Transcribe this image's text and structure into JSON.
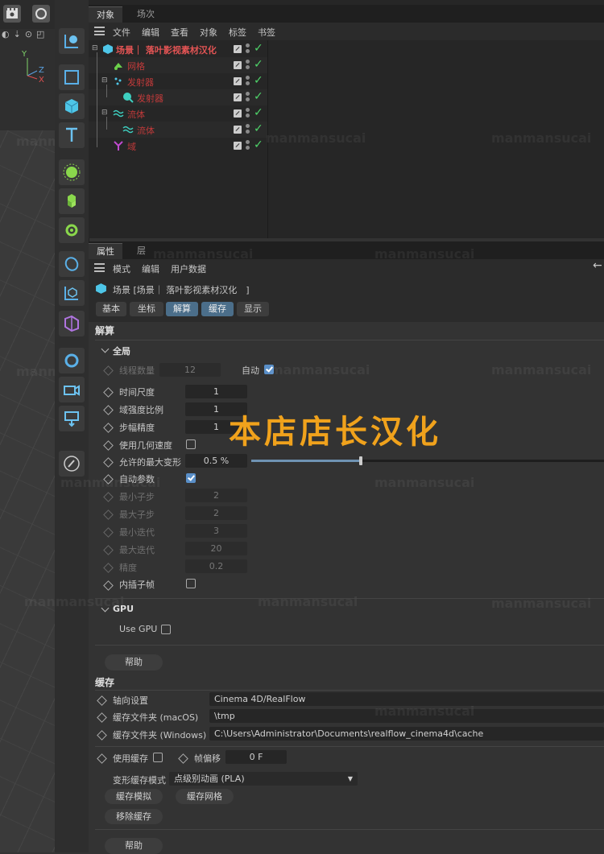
{
  "object_manager": {
    "tabs": [
      "对象",
      "场次"
    ],
    "menu": [
      "文件",
      "编辑",
      "查看",
      "对象",
      "标签",
      "书签"
    ],
    "objects": [
      {
        "name": "场景｜ 落叶影视素材汉化",
        "color": "#e05050",
        "icon": "scene-icon"
      },
      {
        "name": "网格",
        "color": "#c03a3a",
        "icon": "mesh-icon"
      },
      {
        "name": "发射器",
        "color": "#c03a3a",
        "icon": "emitter-icon"
      },
      {
        "name": "发射器",
        "color": "#c03a3a",
        "icon": "emitter-child-icon"
      },
      {
        "name": "流体",
        "color": "#c03a3a",
        "icon": "fluid-icon"
      },
      {
        "name": "流体",
        "color": "#c03a3a",
        "icon": "fluid-child-icon"
      },
      {
        "name": "域",
        "color": "#c03a3a",
        "icon": "domain-icon"
      }
    ]
  },
  "attributes": {
    "tabs": [
      "属性",
      "层"
    ],
    "menu": [
      "模式",
      "编辑",
      "用户数据"
    ],
    "object_title": "场景 [场景｜ 落叶影视素材汉化　]",
    "subtabs": [
      "基本",
      "坐标",
      "解算",
      "缓存",
      "显示"
    ],
    "section_solver": "解算",
    "group_global": "全局",
    "params": [
      {
        "label": "线程数量",
        "value": "12",
        "dim": true
      },
      {
        "label": "时间尺度",
        "value": "1",
        "dim": false
      },
      {
        "label": "域强度比例",
        "value": "1",
        "dim": false
      },
      {
        "label": "步幅精度",
        "value": "1",
        "dim": false
      },
      {
        "label": "使用几何速度",
        "value": "",
        "dim": false
      },
      {
        "label": "允许的最大变形",
        "value": "0.5 %",
        "dim": false
      },
      {
        "label": "自动参数",
        "value": "",
        "dim": false
      },
      {
        "label": "最小子步",
        "value": "2",
        "dim": true
      },
      {
        "label": "最大子步",
        "value": "2",
        "dim": true
      },
      {
        "label": "最小迭代",
        "value": "3",
        "dim": true
      },
      {
        "label": "最大迭代",
        "value": "20",
        "dim": true
      },
      {
        "label": "精度",
        "value": "0.2",
        "dim": true
      },
      {
        "label": "内插子帧",
        "value": "",
        "dim": false
      }
    ],
    "auto_label": "自动",
    "max_deform_slider": 0.31,
    "group_gpu": "GPU",
    "use_gpu_label": "Use GPU",
    "help_label": "帮助",
    "section_cache": "缓存",
    "axis_label": "轴向设置",
    "axis_value": "Cinema 4D/RealFlow",
    "cache_mac_label": "缓存文件夹 (macOS)",
    "cache_mac_value": "\\tmp",
    "cache_win_label": "缓存文件夹 (Windows)",
    "cache_win_value": "C:\\Users\\Administrator\\Documents\\realflow_cinema4d\\cache",
    "use_cache_label": "使用缓存",
    "frame_offset_label": "帧偏移",
    "frame_offset_value": "0 F",
    "deform_mode_label": "变形缓存模式",
    "deform_mode_value": "点级别动画 (PLA)",
    "btn_cache_sim": "缓存模拟",
    "btn_cache_mesh": "缓存网格",
    "btn_remove_cache": "移除缓存",
    "help_label_2": "帮助"
  },
  "viewport": {
    "axis_y": "Y",
    "axis_z": "Z",
    "axis_x": "X"
  },
  "overlay_text": "本店店长汉化",
  "watermark_text": "manmansucai"
}
